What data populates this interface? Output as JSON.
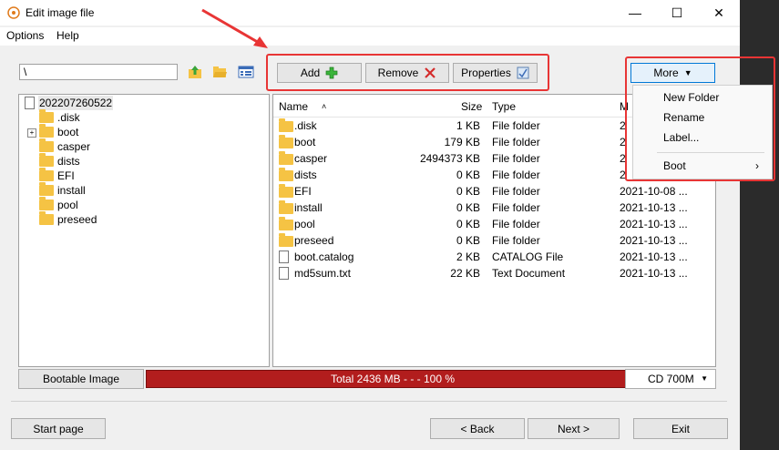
{
  "window": {
    "title": "Edit image file",
    "minimize": "—",
    "maximize": "☐",
    "close": "✕"
  },
  "menu": {
    "options": "Options",
    "help": "Help"
  },
  "path": {
    "value": "\\"
  },
  "toolbar": {
    "add": "Add",
    "remove": "Remove",
    "properties": "Properties",
    "more": "More"
  },
  "tree": {
    "root": "202207260522",
    "items": [
      ".disk",
      "boot",
      "casper",
      "dists",
      "EFI",
      "install",
      "pool",
      "preseed"
    ]
  },
  "list": {
    "headers": {
      "name": "Name",
      "size": "Size",
      "type": "Type",
      "modified": "M"
    },
    "rows": [
      {
        "name": ".disk",
        "size": "1 KB",
        "type": "File folder",
        "date": "2"
      },
      {
        "name": "boot",
        "size": "179 KB",
        "type": "File folder",
        "date": "2"
      },
      {
        "name": "casper",
        "size": "2494373 KB",
        "type": "File folder",
        "date": "2"
      },
      {
        "name": "dists",
        "size": "0 KB",
        "type": "File folder",
        "date": "2"
      },
      {
        "name": "EFI",
        "size": "0 KB",
        "type": "File folder",
        "date": "2021-10-08 ..."
      },
      {
        "name": "install",
        "size": "0 KB",
        "type": "File folder",
        "date": "2021-10-13 ..."
      },
      {
        "name": "pool",
        "size": "0 KB",
        "type": "File folder",
        "date": "2021-10-13 ..."
      },
      {
        "name": "preseed",
        "size": "0 KB",
        "type": "File folder",
        "date": "2021-10-13 ..."
      },
      {
        "name": "boot.catalog",
        "size": "2 KB",
        "type": "CATALOG File",
        "date": "2021-10-13 ..."
      },
      {
        "name": "md5sum.txt",
        "size": "22 KB",
        "type": "Text Document",
        "date": "2021-10-13 ..."
      }
    ]
  },
  "status": {
    "bootable": "Bootable Image",
    "progress_text": "Total  2436 MB   - - -  100 %",
    "progress_fraction": 1.0,
    "media": "CD 700M"
  },
  "more_menu": {
    "items": [
      "New Folder",
      "Rename",
      "Label...",
      "Boot"
    ]
  },
  "footer": {
    "start": "Start page",
    "back": "< Back",
    "next": "Next >",
    "exit": "Exit"
  },
  "colors": {
    "highlight": "#e83535",
    "progress": "#b21d1d"
  }
}
